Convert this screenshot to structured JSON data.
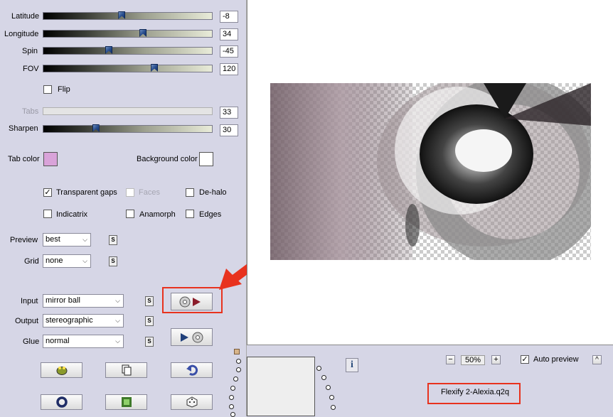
{
  "sliders": [
    {
      "label": "Latitude",
      "value": "-8",
      "fraction": 0.46
    },
    {
      "label": "Longitude",
      "value": "34",
      "fraction": 0.59
    },
    {
      "label": "Spin",
      "value": "-45",
      "fraction": 0.38
    },
    {
      "label": "FOV",
      "value": "120",
      "fraction": 0.66
    },
    {
      "label": "Tabs",
      "value": "33",
      "disabled": true
    },
    {
      "label": "Sharpen",
      "value": "30",
      "fraction": 0.3
    }
  ],
  "flip": {
    "label": "Flip",
    "checked": false
  },
  "colors": {
    "tab_label": "Tab color",
    "tab_color": "#d9a3d9",
    "bg_label": "Background color",
    "bg_color": "#ffffff"
  },
  "options": {
    "transparent_gaps": {
      "label": "Transparent gaps",
      "checked": true
    },
    "faces": {
      "label": "Faces",
      "checked": false,
      "disabled": true
    },
    "de_halo": {
      "label": "De-halo",
      "checked": false
    },
    "indicatrix": {
      "label": "Indicatrix",
      "checked": false
    },
    "anamorph": {
      "label": "Anamorph",
      "checked": false
    },
    "edges": {
      "label": "Edges",
      "checked": false
    }
  },
  "preview_select": {
    "label": "Preview",
    "value": "best"
  },
  "grid_select": {
    "label": "Grid",
    "value": "none"
  },
  "input_select": {
    "label": "Input",
    "value": "mirror ball"
  },
  "output_select": {
    "label": "Output",
    "value": "stereographic"
  },
  "glue_select": {
    "label": "Glue",
    "value": "normal"
  },
  "s_label": "S",
  "zoom": {
    "minus": "−",
    "value": "50%",
    "plus": "+"
  },
  "auto_preview": {
    "label": "Auto preview",
    "checked": true
  },
  "collapse_label": "^",
  "info_label": "i",
  "preset_file": "Flexify 2-Alexia.q2q",
  "accent_color": "#e8321e"
}
